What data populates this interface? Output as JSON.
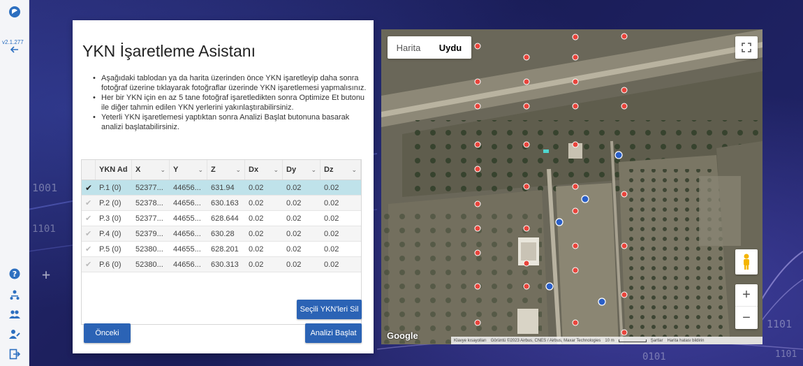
{
  "sidebar": {
    "version": "v2.1.277",
    "icons": [
      "logo-icon",
      "back-arrow-icon",
      "help-icon",
      "user-tree-icon",
      "users-icon",
      "user-edit-icon",
      "logout-icon"
    ]
  },
  "panel": {
    "title": "YKN İşaretleme Asistanı",
    "bullets": [
      "Aşağıdaki tablodan ya da harita üzerinden önce YKN işaretleyip daha sonra fotoğraf üzerine tıklayarak fotoğraflar üzerinde YKN işaretlemesi yapmalısınız.",
      "Her bir YKN için en az 5 tane fotoğraf işaretledikten sonra Optimize Et butonu ile diğer tahmin edilen YKN yerlerini yakınlaştırabilirsiniz.",
      "Yeterli YKN işaretlemesi yaptıktan sonra Analizi Başlat butonuna basarak analizi başlatabilirsiniz."
    ],
    "table": {
      "headers": [
        "YKN Ad",
        "X",
        "Y",
        "Z",
        "Dx",
        "Dy",
        "Dz"
      ],
      "rows": [
        {
          "name": "P.1 (0)",
          "x": "52377...",
          "y": "44656...",
          "z": "631.94",
          "dx": "0.02",
          "dy": "0.02",
          "dz": "0.02",
          "checked": true
        },
        {
          "name": "P.2 (0)",
          "x": "52378...",
          "y": "44656...",
          "z": "630.163",
          "dx": "0.02",
          "dy": "0.02",
          "dz": "0.02",
          "checked": false
        },
        {
          "name": "P.3 (0)",
          "x": "52377...",
          "y": "44655...",
          "z": "628.644",
          "dx": "0.02",
          "dy": "0.02",
          "dz": "0.02",
          "checked": false
        },
        {
          "name": "P.4 (0)",
          "x": "52379...",
          "y": "44656...",
          "z": "630.28",
          "dx": "0.02",
          "dy": "0.02",
          "dz": "0.02",
          "checked": false
        },
        {
          "name": "P.5 (0)",
          "x": "52380...",
          "y": "44655...",
          "z": "628.201",
          "dx": "0.02",
          "dy": "0.02",
          "dz": "0.02",
          "checked": false
        },
        {
          "name": "P.6 (0)",
          "x": "52380...",
          "y": "44656...",
          "z": "630.313",
          "dx": "0.02",
          "dy": "0.02",
          "dz": "0.02",
          "checked": false
        }
      ]
    },
    "buttons": {
      "delete_selected": "Seçili YKN'leri Sil",
      "previous": "Önceki",
      "start_analysis": "Analizi Başlat"
    }
  },
  "map": {
    "tabs": [
      "Harita",
      "Uydu"
    ],
    "active_tab": "Uydu",
    "google_label": "Google",
    "attribution": {
      "shortcuts": "Klavye kısayolları",
      "imagery": "Görüntü ©2023 Airbus, CNES / Airbus, Maxar Technologies",
      "scale": "10 m",
      "terms": "Şartlar",
      "report": "Harita hatası bildirin"
    },
    "zoom_in": "+",
    "zoom_out": "−",
    "marker_color": "#e8453c",
    "camera_marker_color": "#2a5fc8"
  },
  "colors": {
    "accent": "#2b63b5",
    "selected_row": "#bfe2ea"
  }
}
